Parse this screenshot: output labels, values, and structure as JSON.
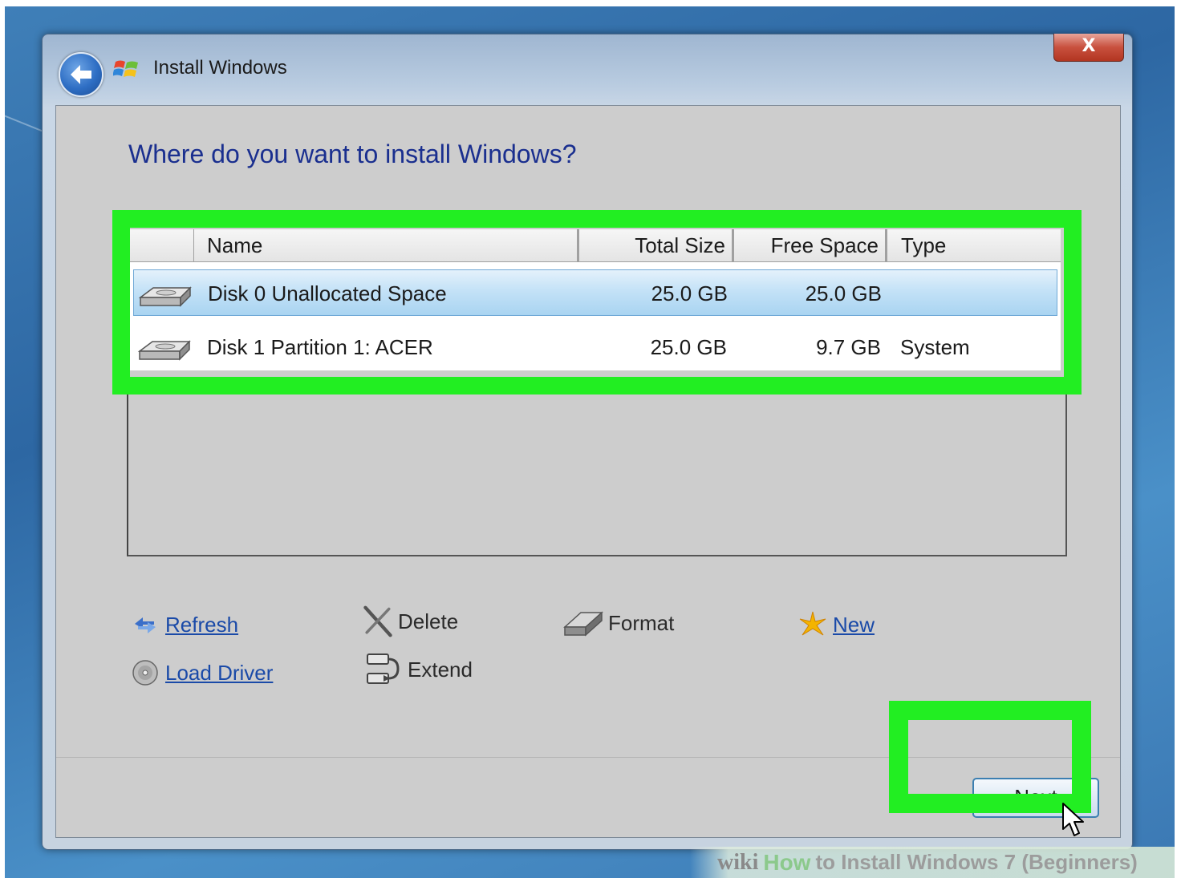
{
  "window": {
    "title": "Install Windows",
    "close_label": "X"
  },
  "heading": "Where do you want to install Windows?",
  "table": {
    "columns": [
      "Name",
      "Total Size",
      "Free Space",
      "Type"
    ],
    "rows": [
      {
        "name": "Disk 0 Unallocated Space",
        "total": "25.0 GB",
        "free": "25.0 GB",
        "type": "",
        "selected": true
      },
      {
        "name": "Disk 1 Partition 1: ACER",
        "total": "25.0 GB",
        "free": "9.7 GB",
        "type": "System",
        "selected": false
      }
    ]
  },
  "actions": {
    "refresh": "Refresh",
    "delete": "Delete",
    "format": "Format",
    "new": "New",
    "load_driver": "Load Driver",
    "extend": "Extend"
  },
  "footer": {
    "next_label": "Next"
  },
  "watermark": {
    "wiki": "wiki",
    "how": "How",
    "rest": "to Install Windows 7 (Beginners)"
  },
  "colors": {
    "highlight": "#22ee22",
    "heading": "#1a2f8f",
    "link": "#1a4aa8"
  }
}
